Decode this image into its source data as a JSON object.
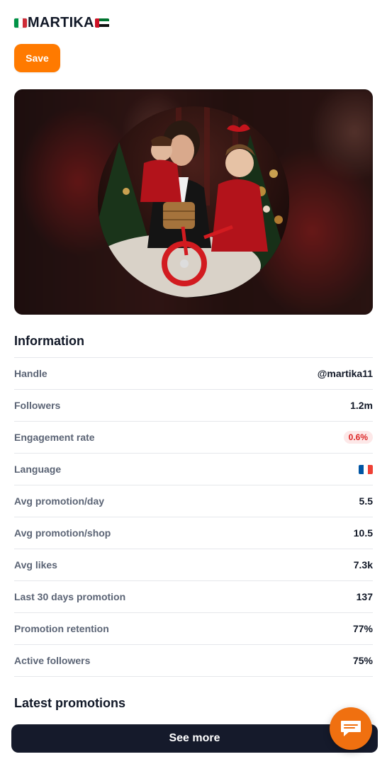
{
  "header": {
    "title": "MARTIKA",
    "flag_left_icon": "italy-flag-icon",
    "flag_right_icon": "uae-flag-icon"
  },
  "actions": {
    "save_label": "Save",
    "see_more_label": "See more"
  },
  "banner": {
    "image": "profile-photo-woman-with-two-girls-christmas"
  },
  "information": {
    "title": "Information",
    "rows": [
      {
        "label": "Handle",
        "value": "@martika11"
      },
      {
        "label": "Followers",
        "value": "1.2m"
      },
      {
        "label": "Engagement rate",
        "value": "0.6%"
      },
      {
        "label": "Language",
        "value": "",
        "icon": "france-flag-icon"
      },
      {
        "label": "Avg promotion/day",
        "value": "5.5"
      },
      {
        "label": "Avg promotion/shop",
        "value": "10.5"
      },
      {
        "label": "Avg likes",
        "value": "7.3k"
      },
      {
        "label": "Last 30 days promotion",
        "value": "137"
      },
      {
        "label": "Promotion retention",
        "value": "77%"
      },
      {
        "label": "Active followers",
        "value": "75%"
      }
    ]
  },
  "promotions": {
    "title": "Latest promotions"
  },
  "chat": {
    "icon": "chat-bubble-icon"
  },
  "colors": {
    "accent": "#ff7a00",
    "dark_button": "#151a2b",
    "negative_badge_text": "#dc2626",
    "negative_badge_bg": "#fde8e8",
    "chat_fab": "#f07010"
  }
}
